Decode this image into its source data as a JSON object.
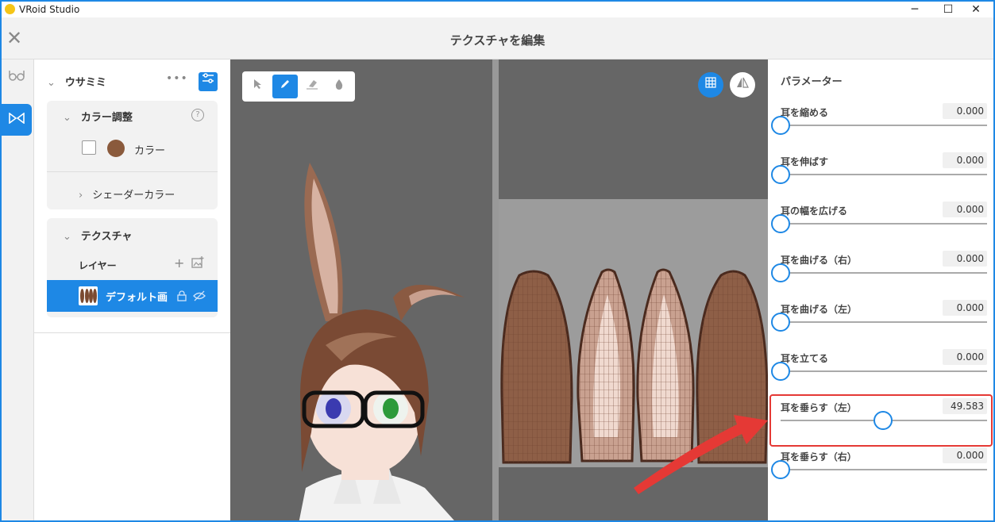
{
  "window": {
    "app_title": "VRoid Studio",
    "minimize": "─",
    "maximize": "☐",
    "close": "✕"
  },
  "header": {
    "title": "テクスチャを編集",
    "close_icon": "✕"
  },
  "left_panel": {
    "section_title": "ウサミミ",
    "more": "•••",
    "color_adjust": {
      "title": "カラー調整",
      "help": "?",
      "color_label": "カラー",
      "color_value": "#8a5a3c"
    },
    "shader_color": "シェーダーカラー",
    "texture": {
      "title": "テクスチャ",
      "layer_label": "レイヤー",
      "add": "+",
      "layer_name": "デフォルト画"
    }
  },
  "params": {
    "title": "パラメーター",
    "items": [
      {
        "label": "耳を縮める",
        "value": "0.000",
        "fraction": 0
      },
      {
        "label": "耳を伸ばす",
        "value": "0.000",
        "fraction": 0
      },
      {
        "label": "耳の幅を広げる",
        "value": "0.000",
        "fraction": 0
      },
      {
        "label": "耳を曲げる（右）",
        "value": "0.000",
        "fraction": 0
      },
      {
        "label": "耳を曲げる（左）",
        "value": "0.000",
        "fraction": 0
      },
      {
        "label": "耳を立てる",
        "value": "0.000",
        "fraction": 0
      },
      {
        "label": "耳を垂らす（左）",
        "value": "49.583",
        "fraction": 0.496
      },
      {
        "label": "耳を垂らす（右）",
        "value": "0.000",
        "fraction": 0
      }
    ]
  },
  "colors": {
    "accent": "#1e88e5",
    "highlight": "#e53935"
  }
}
